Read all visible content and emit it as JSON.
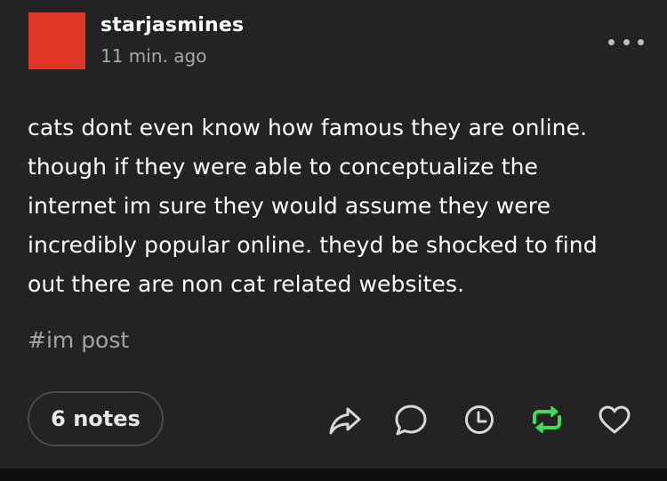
{
  "post": {
    "username": "starjasmines",
    "timestamp": "11 min. ago",
    "avatar_color": "#e03628",
    "body_lines": [
      "cats dont even know how famous they are online.",
      "though if they were able to conceptualize the",
      "internet im sure they would assume they were",
      "incredibly popular online. theyd be shocked to find",
      "out there are non cat related websites."
    ],
    "tags": [
      "#im post"
    ],
    "notes_label": "6 notes"
  },
  "actions": [
    {
      "icon": "share-icon"
    },
    {
      "icon": "reply-icon"
    },
    {
      "icon": "queue-clock-icon"
    },
    {
      "icon": "reblog-icon",
      "color": "#3ddc5a"
    },
    {
      "icon": "heart-icon"
    }
  ],
  "colors": {
    "background": "#232323",
    "text": "#ffffff",
    "muted": "#a8a8a8",
    "reblog_green": "#3ddc5a"
  }
}
